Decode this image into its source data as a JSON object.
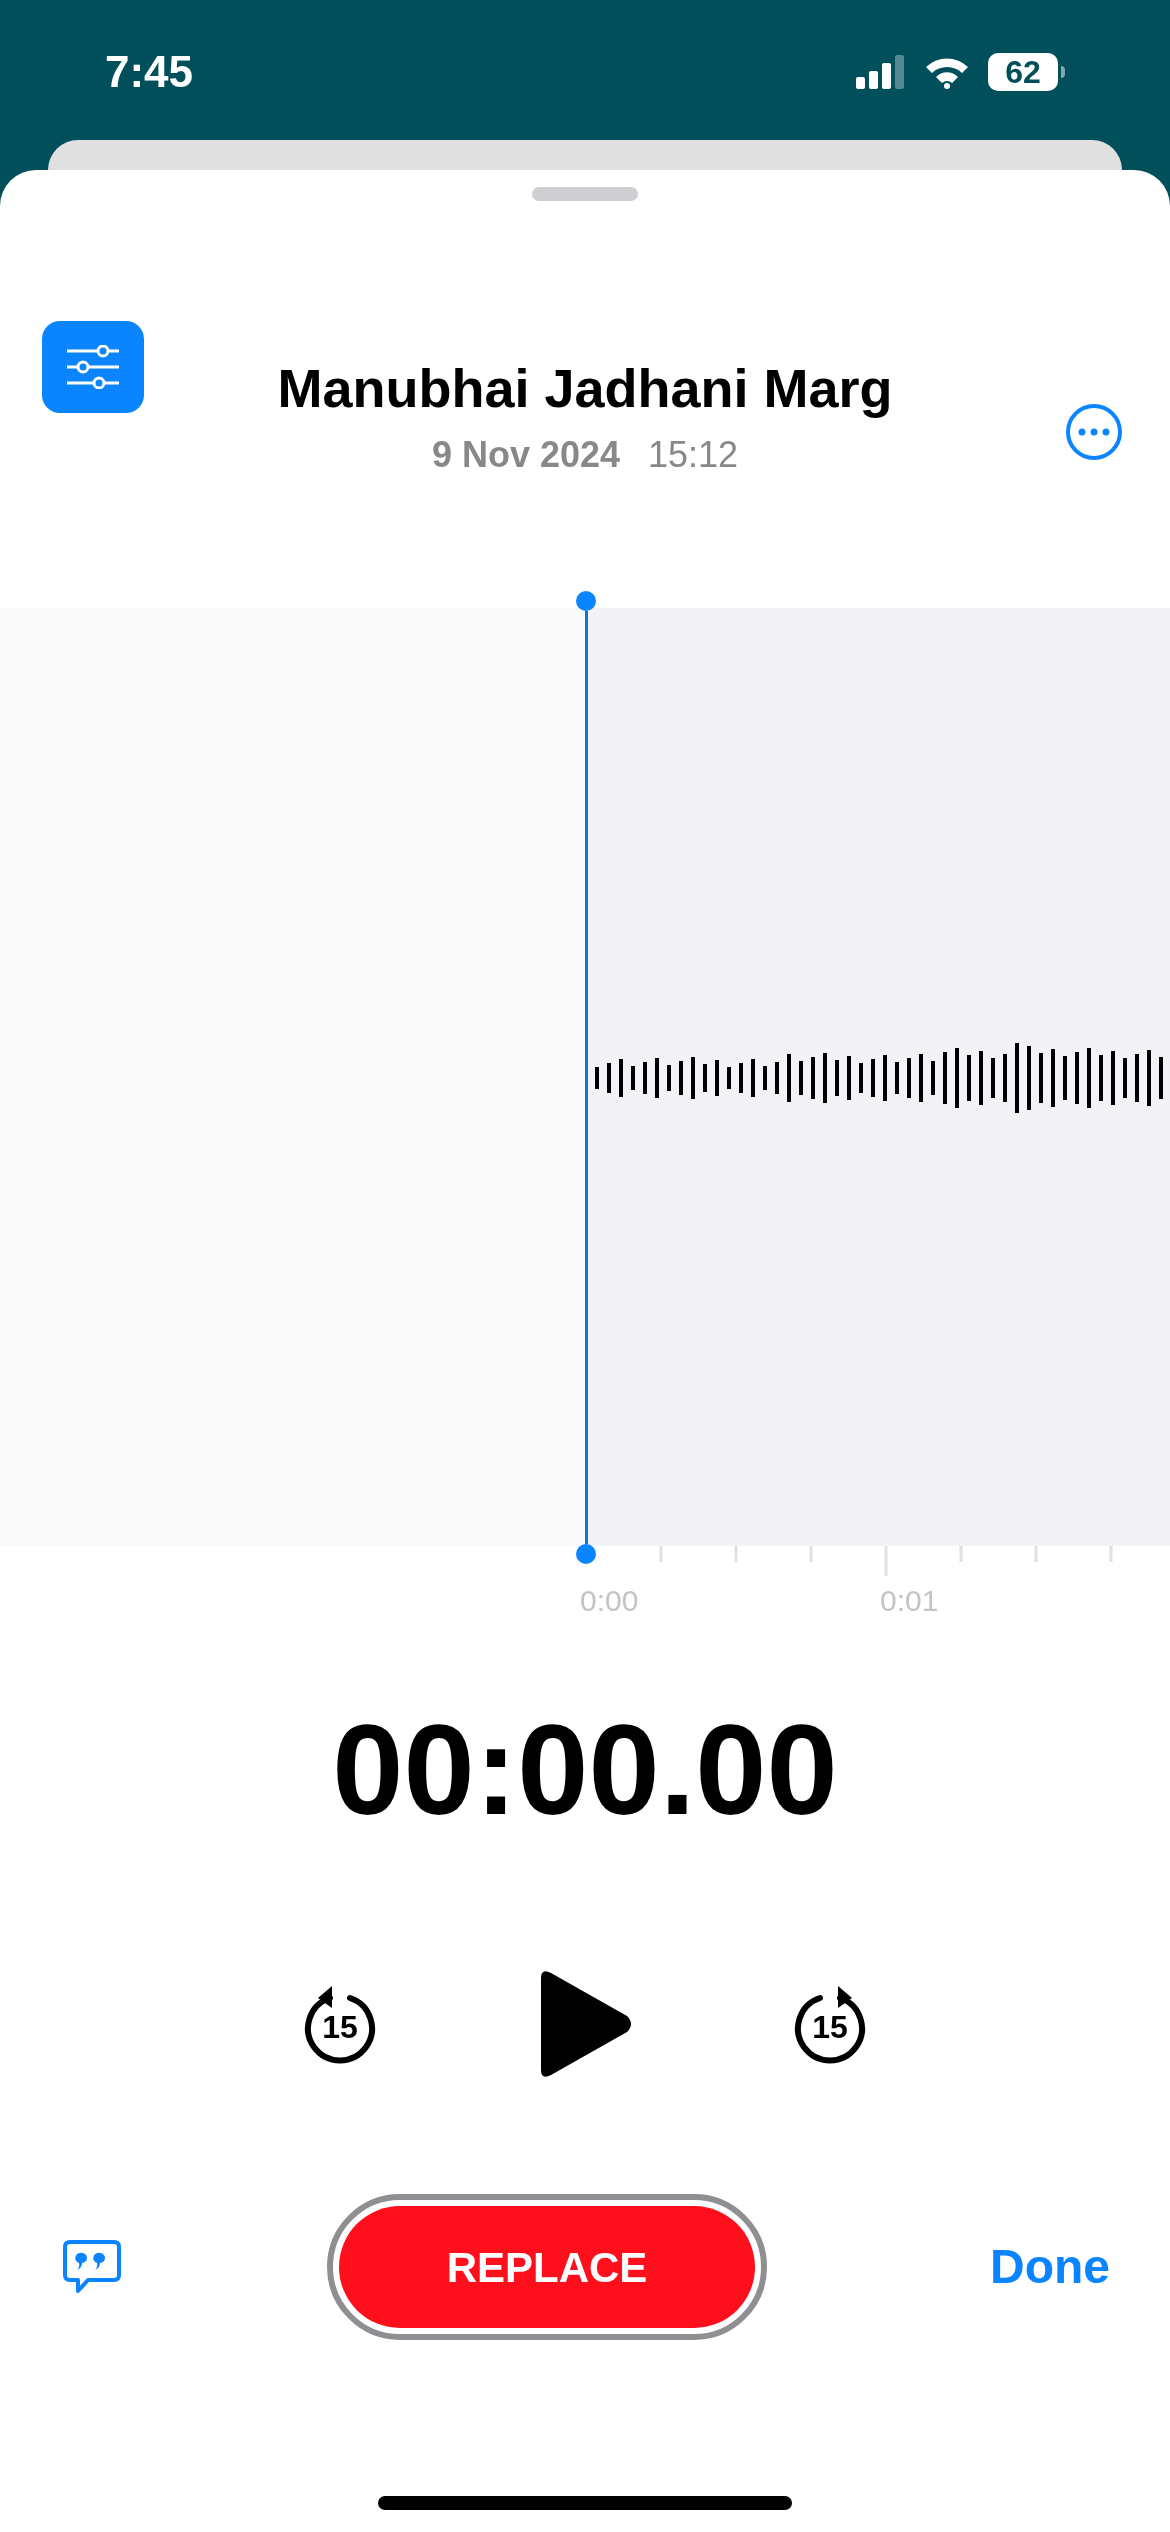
{
  "status_bar": {
    "time": "7:45",
    "battery": "62"
  },
  "header": {
    "title": "Manubhai Jadhani Marg",
    "date": "9 Nov 2024",
    "time": "15:12"
  },
  "timeline": {
    "labels": [
      "0:00",
      "0:01"
    ]
  },
  "timer": "00:00.00",
  "controls": {
    "skip_back": "15",
    "skip_forward": "15"
  },
  "bottom_bar": {
    "replace": "REPLACE",
    "done": "Done"
  }
}
